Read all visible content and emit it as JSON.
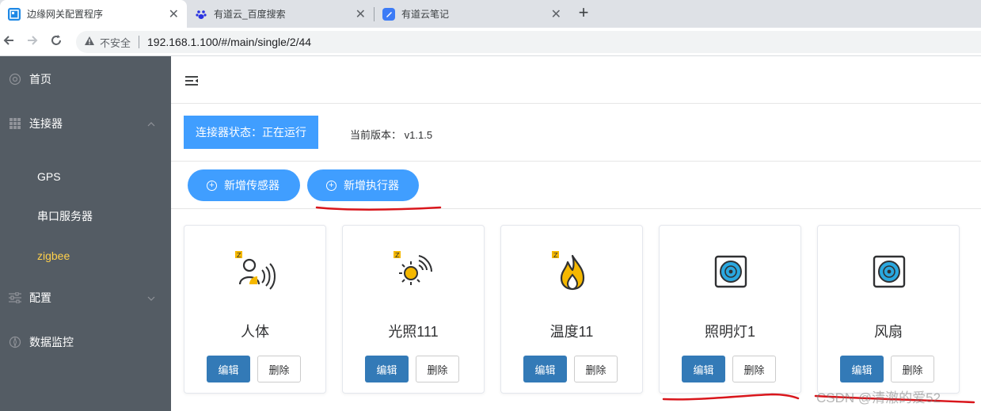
{
  "browser": {
    "tabs": [
      {
        "title": "边缘网关配置程序",
        "active": true,
        "favicon": "gateway-favicon"
      },
      {
        "title": "有道云_百度搜索",
        "active": false,
        "favicon": "baidu-paw-icon"
      },
      {
        "title": "有道云笔记",
        "active": false,
        "favicon": "youdao-note-icon"
      }
    ],
    "close_glyph": "✕",
    "new_tab_glyph": "+",
    "insecure_label": "不安全",
    "url": "192.168.1.100/#/main/single/2/44"
  },
  "sidebar": {
    "bg_color": "#545c64",
    "active_color": "#ffd04b",
    "items": [
      {
        "label": "首页",
        "icon": "gear-icon"
      },
      {
        "label": "连接器",
        "icon": "grid-icon",
        "expanded": true
      },
      {
        "label": "配置",
        "icon": "sliders-icon",
        "expanded": false
      },
      {
        "label": "数据监控",
        "icon": "compass-icon"
      }
    ],
    "subitems": [
      {
        "label": "GPS",
        "active": false
      },
      {
        "label": "串口服务器",
        "active": false
      },
      {
        "label": "zigbee",
        "active": true
      }
    ]
  },
  "header": {
    "collapse_icon": "menu-fold-icon"
  },
  "status": {
    "label": "连接器状态：正在运行",
    "version_label": "当前版本：",
    "version": "v1.1.5"
  },
  "actions": {
    "add_sensor": "新增传感器",
    "add_actuator": "新增执行器",
    "accent_color": "#409eff"
  },
  "devices": [
    {
      "name": "人体",
      "icon": "human-presence-icon",
      "zigbee_badge": "Z"
    },
    {
      "name": "光照111",
      "icon": "light-sensor-icon",
      "zigbee_badge": "Z"
    },
    {
      "name": "温度11",
      "icon": "temperature-flame-icon",
      "zigbee_badge": "Z"
    },
    {
      "name": "照明灯1",
      "icon": "switch-socket-icon",
      "zigbee_badge": ""
    },
    {
      "name": "风扇",
      "icon": "switch-socket-icon",
      "zigbee_badge": ""
    }
  ],
  "buttons": {
    "edit": "编辑",
    "delete": "删除"
  },
  "watermark": "CSDN @清澈的爱52"
}
